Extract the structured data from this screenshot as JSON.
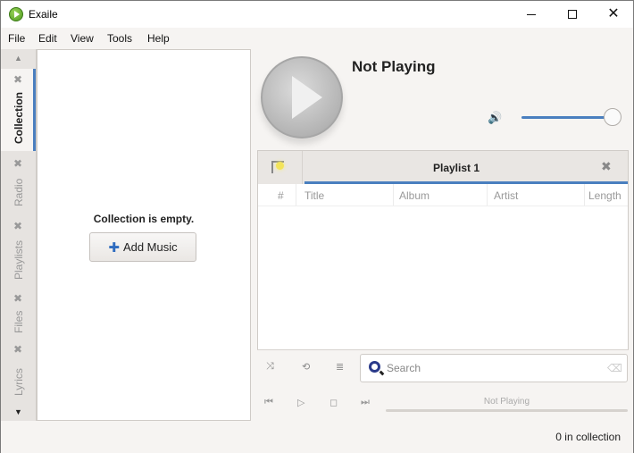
{
  "window": {
    "title": "Exaile",
    "controls": {
      "minimize": "–",
      "maximize": "□",
      "close": "✕"
    }
  },
  "menubar": {
    "items": [
      "File",
      "Edit",
      "View",
      "Tools",
      "Help"
    ]
  },
  "sidebar": {
    "scroll_up": "▲",
    "scroll_down": "▼",
    "tabs": [
      {
        "label": "Collection",
        "active": true,
        "close": "✖"
      },
      {
        "label": "Radio",
        "active": false,
        "close": "✖"
      },
      {
        "label": "Playlists",
        "active": false,
        "close": "✖"
      },
      {
        "label": "Files",
        "active": false,
        "close": "✖"
      },
      {
        "label": "Lyrics",
        "active": false,
        "close": "✖"
      }
    ]
  },
  "collection": {
    "empty_message": "Collection is empty.",
    "add_music_icon": "✚",
    "add_music_label": "Add Music"
  },
  "now_playing": {
    "title": "Not Playing",
    "volume_icon": "🔊",
    "volume_level_percent": 100
  },
  "playlist": {
    "new_tab_icon": "folder-star-icon",
    "tab_label": "Playlist 1",
    "tab_close": "✖",
    "columns": [
      "#",
      "Title",
      "Album",
      "Artist",
      "Length"
    ],
    "rows": []
  },
  "tools": {
    "shuffle_icon": "⤨",
    "repeat_icon": "⟲",
    "dynamic_icon": "≣",
    "search_placeholder": "Search",
    "search_value": "",
    "clear_icon": "⌫"
  },
  "transport": {
    "prev": "⏮",
    "play": "▷",
    "stop": "◻",
    "next": "⏭",
    "progress_label": "Not Playing",
    "progress_percent": 0
  },
  "status": {
    "collection_count": "0 in collection"
  }
}
